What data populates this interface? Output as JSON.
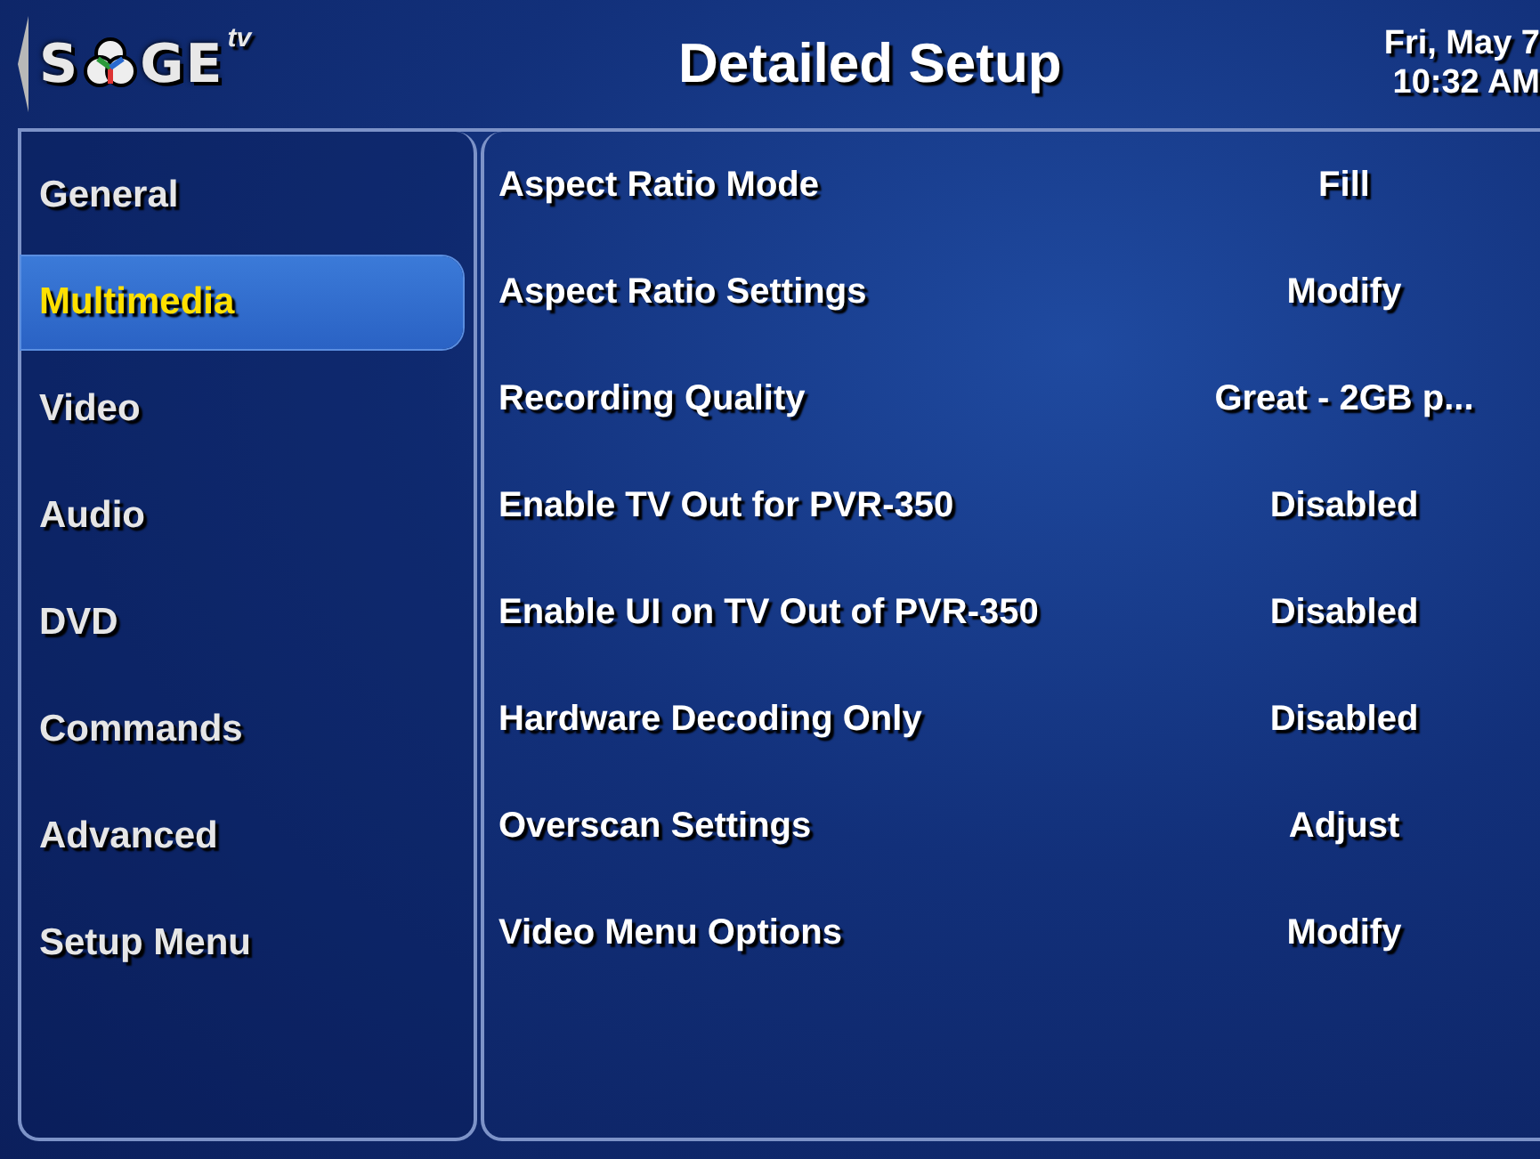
{
  "logo": {
    "left": "S",
    "right": "GE",
    "superscript": "tv"
  },
  "title": "Detailed Setup",
  "clock": {
    "date": "Fri, May 7",
    "time": "10:32 AM"
  },
  "menu": [
    {
      "label": "General",
      "selected": false
    },
    {
      "label": "Multimedia",
      "selected": true
    },
    {
      "label": "Video",
      "selected": false
    },
    {
      "label": "Audio",
      "selected": false
    },
    {
      "label": "DVD",
      "selected": false
    },
    {
      "label": "Commands",
      "selected": false
    },
    {
      "label": "Advanced",
      "selected": false
    },
    {
      "label": "Setup Menu",
      "selected": false
    }
  ],
  "settings": [
    {
      "label": "Aspect Ratio Mode",
      "value": "Fill"
    },
    {
      "label": "Aspect Ratio Settings",
      "value": "Modify"
    },
    {
      "label": "Recording Quality",
      "value": "Great - 2GB p..."
    },
    {
      "label": "Enable TV Out for PVR-350",
      "value": "Disabled"
    },
    {
      "label": "Enable UI on TV Out of PVR-350",
      "value": "Disabled"
    },
    {
      "label": "Hardware Decoding Only",
      "value": "Disabled"
    },
    {
      "label": "Overscan Settings",
      "value": "Adjust"
    },
    {
      "label": "Video Menu Options",
      "value": "Modify"
    }
  ]
}
